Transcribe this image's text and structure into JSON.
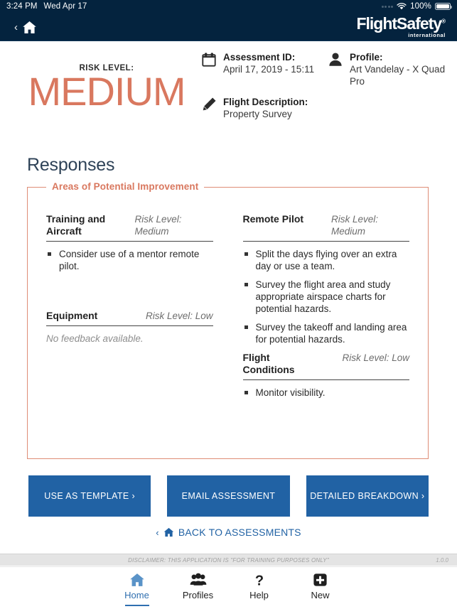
{
  "status_bar": {
    "time": "3:24 PM",
    "date": "Wed Apr 17",
    "battery_percent": "100%",
    "wifi_icon": "wifi-icon",
    "signal_icon": "signal-dots-icon",
    "battery_icon": "battery-full-icon"
  },
  "navbar": {
    "back_chevron": "‹",
    "home_icon": "home-icon",
    "brand_name": "FlightSafety",
    "brand_registered": "®",
    "brand_sub": "international",
    "background": "#04233E"
  },
  "summary": {
    "risk_label": "RISK LEVEL:",
    "risk_value": "MEDIUM",
    "risk_color": "#D9785F",
    "assessment": {
      "icon": "calendar-icon",
      "label": "Assessment ID:",
      "value": "April 17, 2019 - 15:11"
    },
    "profile": {
      "icon": "person-icon",
      "label": "Profile:",
      "value": "Art Vandelay - X Quad Pro"
    },
    "flight_description": {
      "icon": "pencil-icon",
      "label": "Flight Description:",
      "value": "Property Survey"
    }
  },
  "responses": {
    "heading": "Responses",
    "legend": "Areas of Potential Improvement",
    "border_color": "#DE8D76",
    "no_feedback_text": "No feedback available.",
    "categories": [
      {
        "name": "Training and Aircraft",
        "risk": "Risk Level: Medium",
        "items": [
          "Consider use of a mentor remote pilot."
        ],
        "column": "left",
        "row": 1
      },
      {
        "name": "Remote Pilot",
        "risk": "Risk Level: Medium",
        "items": [
          "Split the days flying over an extra day or use a team.",
          "Survey the flight area and study appropriate airspace charts for potential hazards.",
          "Survey the takeoff and landing area for potential hazards."
        ],
        "column": "right",
        "row": 1
      },
      {
        "name": "Equipment",
        "risk": "Risk Level: Low",
        "items": [],
        "column": "left",
        "row": 2
      },
      {
        "name": "Flight Conditions",
        "risk": "Risk Level: Low",
        "items": [
          "Monitor visibility."
        ],
        "column": "right",
        "row": 2
      }
    ]
  },
  "actions": {
    "buttons": [
      {
        "label": "USE AS TEMPLATE ›",
        "name": "use-as-template-button"
      },
      {
        "label": "EMAIL ASSESSMENT",
        "name": "email-assessment-button"
      },
      {
        "label": "DETAILED BREAKDOWN ›",
        "name": "detailed-breakdown-button"
      }
    ],
    "button_color": "#2162A4",
    "back_link": {
      "chevron": "‹",
      "icon": "home-icon",
      "label": "BACK TO ASSESSMENTS"
    }
  },
  "footer": {
    "disclaimer": "DISCLAIMER: THIS APPLICATION IS \"FOR TRAINING PURPOSES ONLY\"",
    "version": "1.0.0"
  },
  "tabbar": {
    "tabs": [
      {
        "label": "Home",
        "icon": "home-icon",
        "active": true
      },
      {
        "label": "Profiles",
        "icon": "people-icon",
        "active": false
      },
      {
        "label": "Help",
        "icon": "question-icon",
        "active": false
      },
      {
        "label": "New",
        "icon": "plus-square-icon",
        "active": false
      }
    ],
    "active_color": "#2f6fb0"
  }
}
